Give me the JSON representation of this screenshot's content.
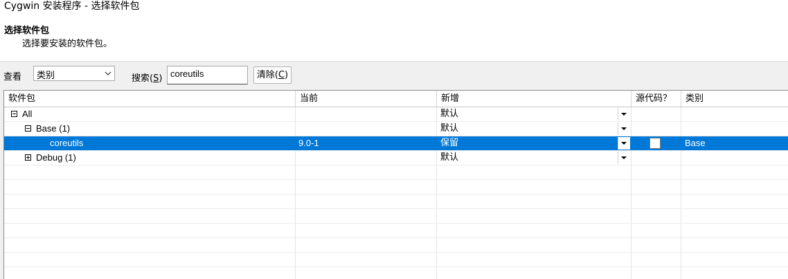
{
  "window": {
    "title": "Cygwin 安装程序 - 选择软件包"
  },
  "header": {
    "heading": "选择软件包",
    "subheading": "选择要安装的软件包。"
  },
  "toolbar": {
    "view_label": "查看",
    "view_value": "类别",
    "search_label_main": "搜索(",
    "search_label_key": "S",
    "search_label_end": ")",
    "search_value": "coreutils",
    "clear_label_main": "清除(",
    "clear_label_key": "C",
    "clear_label_end": ")"
  },
  "grid": {
    "columns": [
      "软件包",
      "当前",
      "新增",
      "源代码？",
      "类别"
    ],
    "rows": [
      {
        "package": "All",
        "current": "",
        "new": "默认",
        "category": ""
      },
      {
        "package": "Base (1)",
        "current": "",
        "new": "默认",
        "category": ""
      },
      {
        "package": "coreutils",
        "current": "9.0-1",
        "new": "保留",
        "category": "Base"
      },
      {
        "package": "Debug (1)",
        "current": "",
        "new": "默认",
        "category": ""
      }
    ]
  },
  "colors": {
    "selection": "#0078d7",
    "background": "#f0f0f0"
  }
}
